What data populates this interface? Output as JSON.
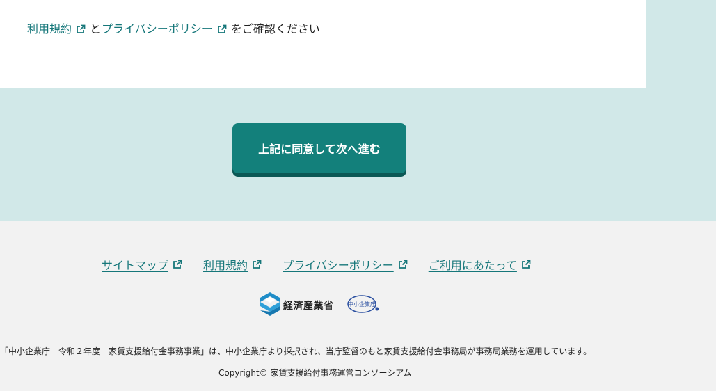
{
  "consent": {
    "terms_label": "利用規約",
    "connector": "と",
    "privacy_label": "プライバシーポリシー",
    "suffix": "をご確認ください"
  },
  "actions": {
    "agree_button_label": "上記に同意して次へ進む"
  },
  "footer": {
    "links": [
      {
        "label": "サイトマップ"
      },
      {
        "label": "利用規約"
      },
      {
        "label": "プライバシーポリシー"
      },
      {
        "label": "ご利用にあたって"
      }
    ],
    "meti_logo_text": "経済産業省",
    "sme_logo_text": "中小企業庁",
    "note": "「中小企業庁　令和２年度　家賃支援給付金事務事業」は、中小企業庁より採択され、当庁監督のもと家賃支援給付金事務局が事務局業務を運用しています。",
    "copyright": "Copyright© 家賃支援給付事務運営コンソーシアム"
  },
  "colors": {
    "accent": "#16777a",
    "button": "#13807b",
    "band": "#d1e8e8",
    "footer_bg": "#f2f2f2"
  },
  "icons": [
    "external-link-icon",
    "meti-logo-icon",
    "sme-agency-logo"
  ]
}
